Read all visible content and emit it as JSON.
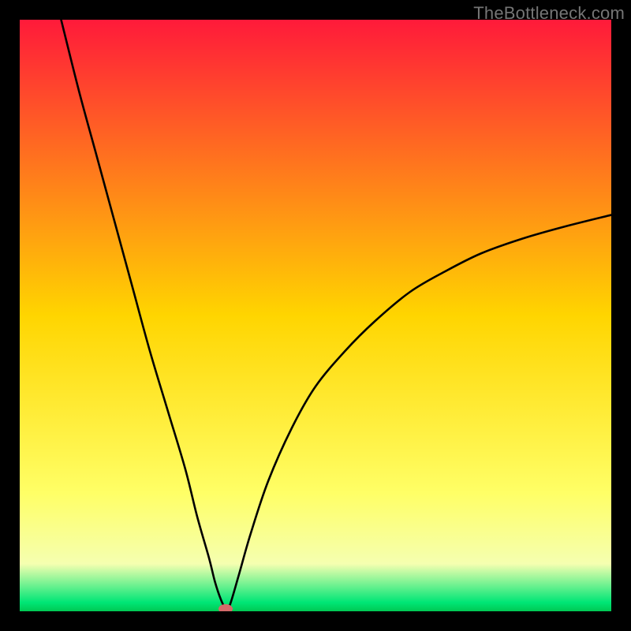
{
  "watermark": "TheBottleneck.com",
  "chart_data": {
    "type": "line",
    "title": "",
    "xlabel": "",
    "ylabel": "",
    "xlim": [
      0,
      100
    ],
    "ylim": [
      0,
      100
    ],
    "grid": false,
    "legend": false,
    "background_gradient": {
      "stops": [
        {
          "offset": 0.0,
          "color": "#ff1a3a"
        },
        {
          "offset": 0.5,
          "color": "#ffd500"
        },
        {
          "offset": 0.8,
          "color": "#ffff66"
        },
        {
          "offset": 0.92,
          "color": "#f5ffb0"
        },
        {
          "offset": 0.985,
          "color": "#00e676"
        },
        {
          "offset": 1.0,
          "color": "#00c853"
        }
      ]
    },
    "series": [
      {
        "name": "bottleneck-curve",
        "x": [
          7,
          10,
          13,
          16,
          19,
          22,
          25,
          28,
          30,
          32,
          33,
          34,
          34.8,
          35.5,
          37,
          39,
          42,
          46,
          50,
          55,
          60,
          66,
          72,
          78,
          85,
          92,
          100
        ],
        "values": [
          100,
          88,
          77,
          66,
          55,
          44,
          34,
          24,
          16,
          9,
          5,
          2,
          0.5,
          1,
          6,
          13,
          22,
          31,
          38,
          44,
          49,
          54,
          57.5,
          60.5,
          63,
          65,
          67
        ]
      }
    ],
    "marker": {
      "name": "optimal-point",
      "x": 34.8,
      "y": 0.4,
      "rx": 1.2,
      "ry": 0.8,
      "color": "#d46a6a"
    }
  }
}
